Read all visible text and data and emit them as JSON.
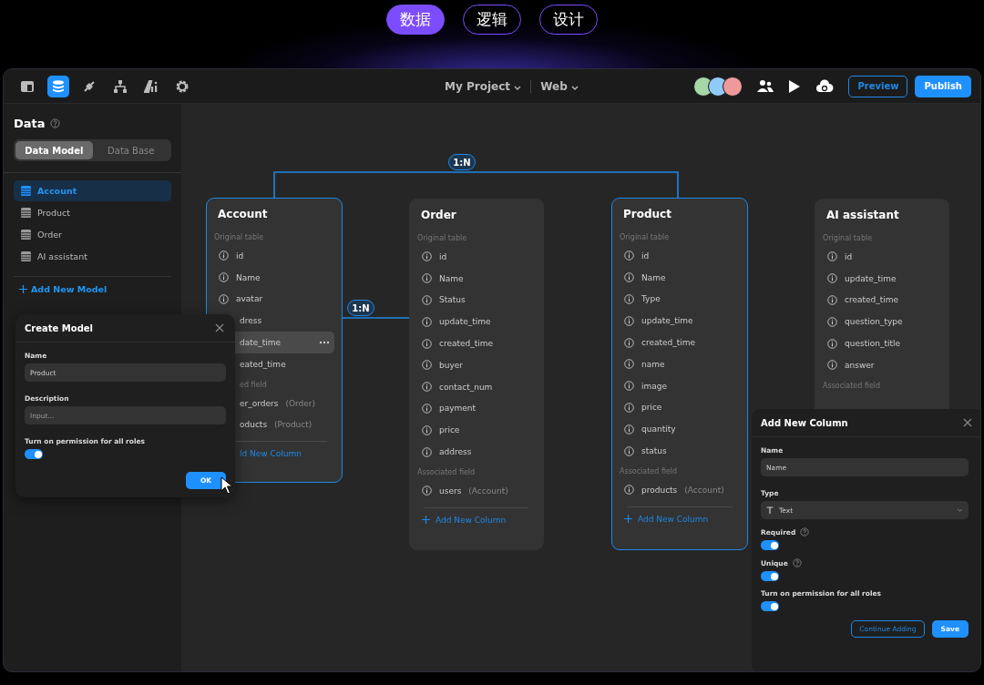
{
  "top_tabs": [
    {
      "label": "数据",
      "selected": true
    },
    {
      "label": "逻辑",
      "selected": false
    },
    {
      "label": "设计",
      "selected": false
    }
  ],
  "toolbar": {
    "tools": [
      {
        "selected": false
      },
      {
        "selected": true
      },
      {
        "selected": false
      },
      {
        "selected": false
      },
      {
        "selected": false
      },
      {
        "selected": false
      }
    ],
    "project": "My Project",
    "platform": "Web",
    "preview": "Preview",
    "publish": "Publish"
  },
  "sidebar": {
    "title": "Data",
    "segments": [
      {
        "label": "Data Model",
        "selected": true
      },
      {
        "label": "Data Base",
        "selected": false
      }
    ],
    "items": [
      {
        "label": "Account",
        "selected": true
      },
      {
        "label": "Product",
        "selected": false
      },
      {
        "label": "Order",
        "selected": false
      },
      {
        "label": "AI assistant",
        "selected": false
      }
    ],
    "add_label": "Add New Model"
  },
  "cards": [
    {
      "title": "Account",
      "selected": true,
      "add_icon": false,
      "add_label": "ld New Column",
      "sections": [
        {
          "label": "Original table",
          "fields": [
            {
              "kind": "info",
              "name": "id",
              "highlighted": false
            },
            {
              "kind": "info",
              "name": "Name",
              "highlighted": false
            },
            {
              "kind": "info",
              "name": "avatar",
              "highlighted": false
            },
            {
              "kind": "cut",
              "name": "dress",
              "highlighted": false
            },
            {
              "kind": "cut",
              "name": "date_time",
              "highlighted": true
            },
            {
              "kind": "cut",
              "name": "eated_time",
              "highlighted": false
            }
          ]
        },
        {
          "label": "ed field",
          "kind": "cut",
          "fields": [
            {
              "kind": "cut",
              "name": "er_orders",
              "type": "(Order)",
              "highlighted": false
            },
            {
              "kind": "cut",
              "name": "oducts",
              "type": "(Product)",
              "highlighted": false
            }
          ]
        }
      ]
    },
    {
      "title": "Order",
      "selected": false,
      "add_icon": true,
      "add_label": "Add New Column",
      "sections": [
        {
          "label": "Original table",
          "fields": [
            {
              "kind": "info",
              "name": "id"
            },
            {
              "kind": "info",
              "name": "Name"
            },
            {
              "kind": "info",
              "name": "Status"
            },
            {
              "kind": "info",
              "name": "update_time"
            },
            {
              "kind": "info",
              "name": "created_time"
            },
            {
              "kind": "info",
              "name": "buyer"
            },
            {
              "kind": "info",
              "name": "contact_num"
            },
            {
              "kind": "info",
              "name": "payment"
            },
            {
              "kind": "info",
              "name": "price"
            },
            {
              "kind": "info",
              "name": "address"
            }
          ]
        },
        {
          "label": "Associated field",
          "fields": [
            {
              "kind": "info",
              "name": "users",
              "type": "(Account)"
            }
          ]
        }
      ]
    },
    {
      "title": "Product",
      "selected": true,
      "add_icon": true,
      "add_label": "Add New Column",
      "sections": [
        {
          "label": "Original table",
          "fields": [
            {
              "kind": "info",
              "name": "id"
            },
            {
              "kind": "info",
              "name": "Name"
            },
            {
              "kind": "info",
              "name": "Type"
            },
            {
              "kind": "info",
              "name": "update_time"
            },
            {
              "kind": "info",
              "name": "created_time"
            },
            {
              "kind": "info",
              "name": "name"
            },
            {
              "kind": "info",
              "name": "image"
            },
            {
              "kind": "info",
              "name": "price"
            },
            {
              "kind": "info",
              "name": "quantity"
            },
            {
              "kind": "info",
              "name": "status"
            }
          ]
        },
        {
          "label": "Associated field",
          "fields": [
            {
              "kind": "info",
              "name": "products",
              "type": "(Account)"
            }
          ]
        }
      ]
    },
    {
      "title": "AI assistant",
      "selected": false,
      "sections": [
        {
          "label": "Original table",
          "fields": [
            {
              "kind": "info",
              "name": "id"
            },
            {
              "kind": "info",
              "name": "update_time"
            },
            {
              "kind": "info",
              "name": "created_time"
            },
            {
              "kind": "info",
              "name": "question_type"
            },
            {
              "kind": "info",
              "name": "question_title"
            },
            {
              "kind": "info",
              "name": "answer"
            }
          ]
        },
        {
          "label": "Associated field"
        }
      ]
    }
  ],
  "relations": [
    {
      "label": "1:N"
    },
    {
      "label": "1:N"
    }
  ],
  "create_model": {
    "title": "Create Model",
    "name_label": "Name",
    "name_value": "Product",
    "description_label": "Description",
    "description_placeholder": "Input...",
    "permission_label": "Turn on permission for all roles",
    "permission_on": true,
    "ok": "OK"
  },
  "add_column": {
    "title": "Add New Column",
    "name_label": "Name",
    "name_value": "Name",
    "type_label": "Type",
    "type_value": "Text",
    "toggles": [
      {
        "label": "Required",
        "help": true,
        "on": true
      },
      {
        "label": "Unique",
        "help": true,
        "on": true
      },
      {
        "label": "Turn on permission for all roles",
        "help": false,
        "on": true
      }
    ],
    "secondary": "Continue Adding",
    "primary": "Save"
  }
}
